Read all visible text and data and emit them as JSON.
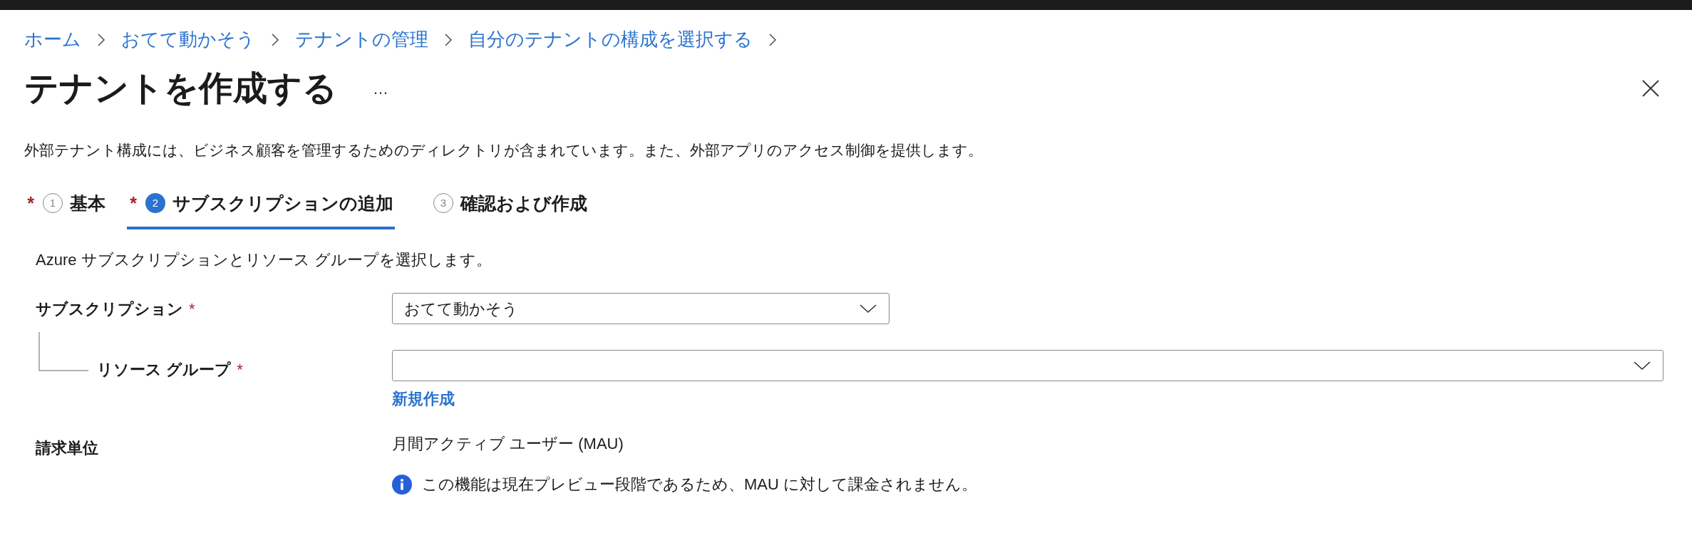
{
  "breadcrumb": [
    "ホーム",
    "おてて動かそう",
    "テナントの管理",
    "自分のテナントの構成を選択する"
  ],
  "title": "テナントを作成する",
  "more_menu": "…",
  "description": "外部テナント構成には、ビジネス顧客を管理するためのディレクトリが含まれています。また、外部アプリのアクセス制御を提供します。",
  "tabs": [
    {
      "required_mark": "*",
      "number": "1",
      "label": "基本",
      "selected": false
    },
    {
      "required_mark": "*",
      "number": "2",
      "label": "サブスクリプションの追加",
      "selected": true
    },
    {
      "number": "3",
      "label": "確認および作成",
      "selected": false
    }
  ],
  "section_intro": "Azure サブスクリプションとリソース グループを選択します。",
  "subscription": {
    "label": "サブスクリプション",
    "required_mark": "*",
    "value": "おてて動かそう"
  },
  "resource_group": {
    "label": "リソース グループ",
    "required_mark": "*",
    "create_link": "新規作成"
  },
  "billing": {
    "label": "請求単位",
    "value": "月間アクティブ ユーザー (MAU)",
    "info": "この機能は現在プレビュー段階であるため、MAU に対して課金されません。"
  }
}
